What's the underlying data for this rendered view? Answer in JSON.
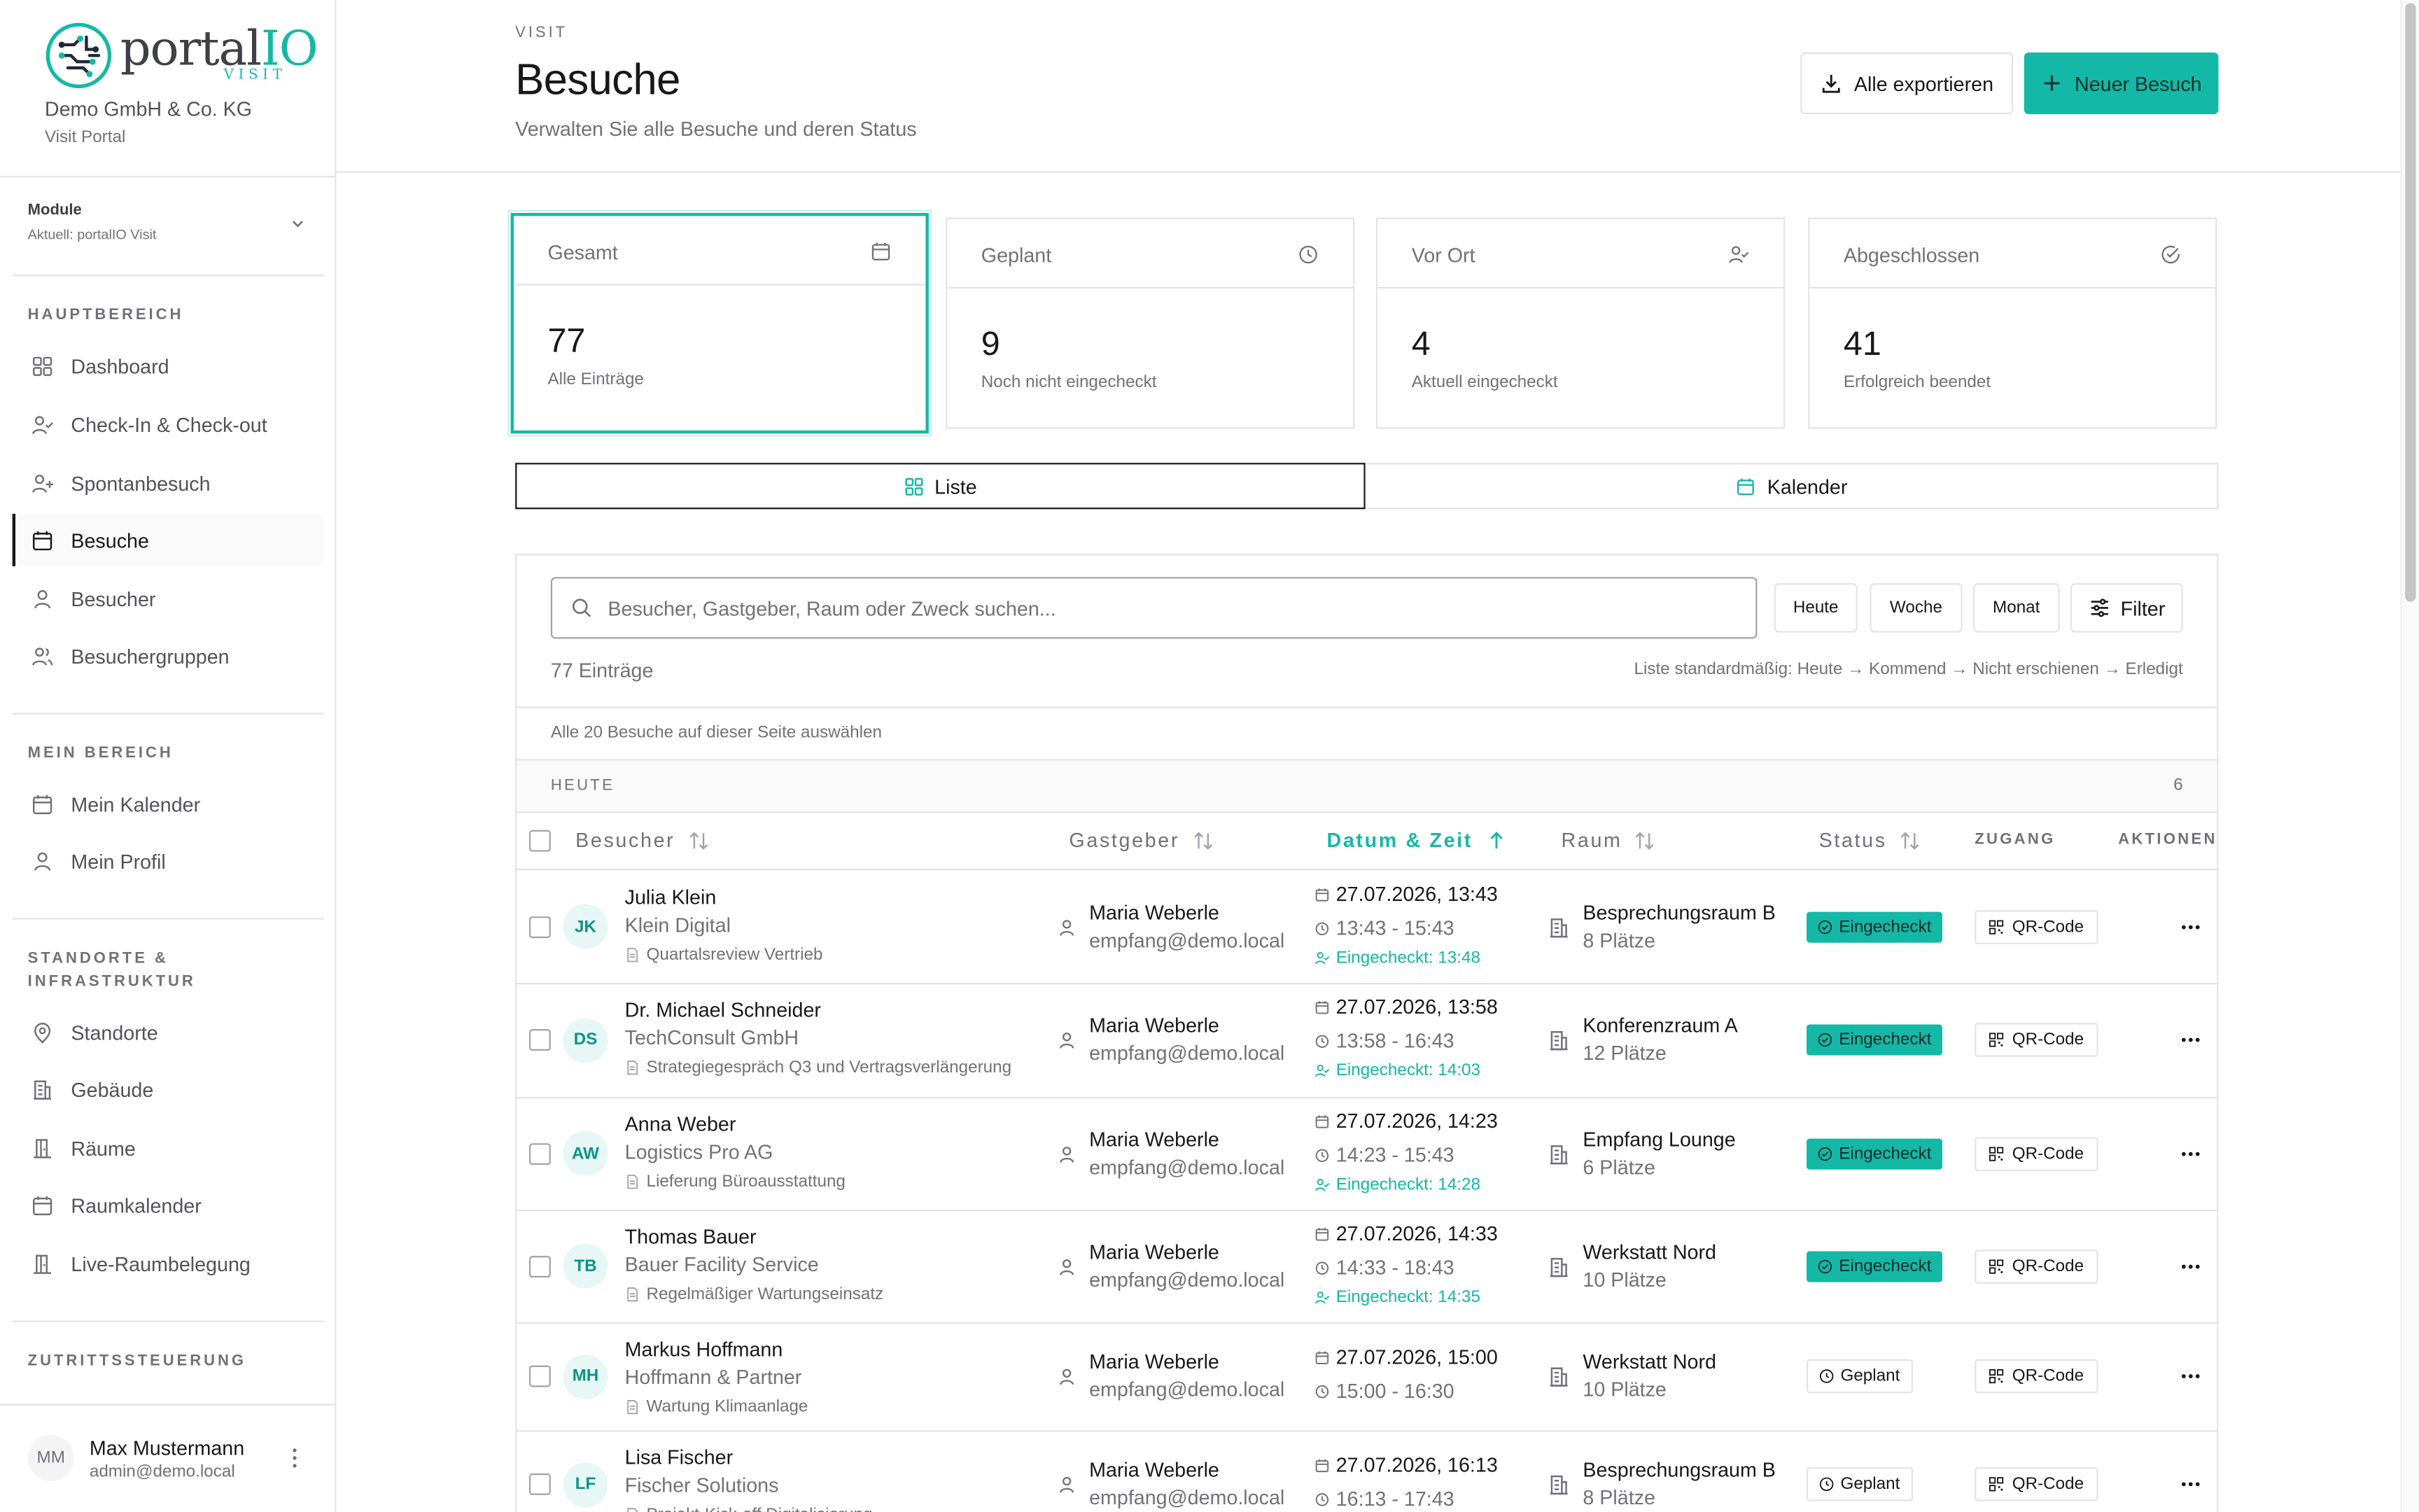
{
  "brand": {
    "name_prefix": "portal",
    "name_suffix": "IO",
    "product": "VISIT",
    "org": "Demo GmbH & Co. KG",
    "portal": "Visit Portal"
  },
  "module": {
    "label": "Module",
    "current": "Aktuell: portalIO Visit"
  },
  "sidebar": {
    "sections": [
      {
        "title": "HAUPTBEREICH",
        "items": [
          {
            "label": "Dashboard",
            "icon": "dashboard-icon"
          },
          {
            "label": "Check-In & Check-out",
            "icon": "user-check-icon"
          },
          {
            "label": "Spontanbesuch",
            "icon": "user-plus-icon"
          },
          {
            "label": "Besuche",
            "icon": "calendar-icon",
            "active": true
          },
          {
            "label": "Besucher",
            "icon": "user-icon"
          },
          {
            "label": "Besuchergruppen",
            "icon": "users-icon"
          }
        ]
      },
      {
        "title": "MEIN BEREICH",
        "items": [
          {
            "label": "Mein Kalender",
            "icon": "calendar-icon"
          },
          {
            "label": "Mein Profil",
            "icon": "user-icon"
          }
        ]
      },
      {
        "title": "STANDORTE & INFRASTRUKTUR",
        "title_line1": "STANDORTE &",
        "title_line2": "INFRASTRUKTUR",
        "items": [
          {
            "label": "Standorte",
            "icon": "map-pin-icon"
          },
          {
            "label": "Gebäude",
            "icon": "building-icon"
          },
          {
            "label": "Räume",
            "icon": "door-icon"
          },
          {
            "label": "Raumkalender",
            "icon": "calendar-icon"
          },
          {
            "label": "Live-Raumbelegung",
            "icon": "door-icon"
          }
        ]
      },
      {
        "title": "ZUTRITTSSTEUERUNG",
        "items": []
      }
    ]
  },
  "user": {
    "initials": "MM",
    "name": "Max Mustermann",
    "email": "admin@demo.local"
  },
  "header": {
    "overline": "VISIT",
    "title": "Besuche",
    "subtitle": "Verwalten Sie alle Besuche und deren Status",
    "export_label": "Alle exportieren",
    "new_label": "Neuer Besuch"
  },
  "stats": [
    {
      "label": "Gesamt",
      "value": "77",
      "desc": "Alle Einträge",
      "icon": "calendar-icon",
      "active": true
    },
    {
      "label": "Geplant",
      "value": "9",
      "desc": "Noch nicht eingecheckt",
      "icon": "clock-icon"
    },
    {
      "label": "Vor Ort",
      "value": "4",
      "desc": "Aktuell eingecheckt",
      "icon": "user-check-icon"
    },
    {
      "label": "Abgeschlossen",
      "value": "41",
      "desc": "Erfolgreich beendet",
      "icon": "check-circle-icon"
    }
  ],
  "view_tabs": [
    {
      "label": "Liste",
      "active": true
    },
    {
      "label": "Kalender"
    }
  ],
  "toolbar": {
    "search_placeholder": "Besucher, Gastgeber, Raum oder Zweck suchen...",
    "quick": [
      "Heute",
      "Woche",
      "Monat"
    ],
    "filter_label": "Filter",
    "count": "77 Einträge",
    "hint": "Liste standardmäßig: Heute → Kommend → Nicht erschienen → Erledigt",
    "select_all": "Alle 20 Besuche auf dieser Seite auswählen"
  },
  "group": {
    "label": "HEUTE",
    "count": "6"
  },
  "columns": {
    "visitor": "Besucher",
    "host": "Gastgeber",
    "datetime": "Datum & Zeit",
    "room": "Raum",
    "status": "Status",
    "access": "ZUGANG",
    "actions": "AKTIONEN"
  },
  "visits": [
    {
      "initials": "JK",
      "name": "Julia Klein",
      "company": "Klein Digital",
      "purpose": "Quartalsreview Vertrieb",
      "host": "Maria Weberle",
      "host_email": "empfang@demo.local",
      "date": "27.07.2026, 13:43",
      "time": "13:43 - 15:43",
      "checkin": "Eingecheckt: 13:48",
      "room": "Besprechungsraum B",
      "capacity": "8 Plätze",
      "status": "Eingecheckt",
      "status_type": "checked-in",
      "access": "QR-Code"
    },
    {
      "initials": "DS",
      "name": "Dr. Michael Schneider",
      "company": "TechConsult GmbH",
      "purpose": "Strategiegespräch Q3 und Vertragsverlängerung",
      "host": "Maria Weberle",
      "host_email": "empfang@demo.local",
      "date": "27.07.2026, 13:58",
      "time": "13:58 - 16:43",
      "checkin": "Eingecheckt: 14:03",
      "room": "Konferenzraum A",
      "capacity": "12 Plätze",
      "status": "Eingecheckt",
      "status_type": "checked-in",
      "access": "QR-Code"
    },
    {
      "initials": "AW",
      "name": "Anna Weber",
      "company": "Logistics Pro AG",
      "purpose": "Lieferung Büroausstattung",
      "host": "Maria Weberle",
      "host_email": "empfang@demo.local",
      "date": "27.07.2026, 14:23",
      "time": "14:23 - 15:43",
      "checkin": "Eingecheckt: 14:28",
      "room": "Empfang Lounge",
      "capacity": "6 Plätze",
      "status": "Eingecheckt",
      "status_type": "checked-in",
      "access": "QR-Code"
    },
    {
      "initials": "TB",
      "name": "Thomas Bauer",
      "company": "Bauer Facility Service",
      "purpose": "Regelmäßiger Wartungseinsatz",
      "host": "Maria Weberle",
      "host_email": "empfang@demo.local",
      "date": "27.07.2026, 14:33",
      "time": "14:33 - 18:43",
      "checkin": "Eingecheckt: 14:35",
      "room": "Werkstatt Nord",
      "capacity": "10 Plätze",
      "status": "Eingecheckt",
      "status_type": "checked-in",
      "access": "QR-Code"
    },
    {
      "initials": "MH",
      "name": "Markus Hoffmann",
      "company": "Hoffmann & Partner",
      "purpose": "Wartung Klimaanlage",
      "host": "Maria Weberle",
      "host_email": "empfang@demo.local",
      "date": "27.07.2026, 15:00",
      "time": "15:00 - 16:30",
      "checkin": "",
      "room": "Werkstatt Nord",
      "capacity": "10 Plätze",
      "status": "Geplant",
      "status_type": "planned",
      "access": "QR-Code"
    },
    {
      "initials": "LF",
      "name": "Lisa Fischer",
      "company": "Fischer Solutions",
      "purpose": "Projekt-Kick-off Digitalisierung",
      "host": "Maria Weberle",
      "host_email": "empfang@demo.local",
      "date": "27.07.2026, 16:13",
      "time": "16:13 - 17:43",
      "checkin": "",
      "room": "Besprechungsraum B",
      "capacity": "8 Plätze",
      "status": "Geplant",
      "status_type": "planned",
      "access": "QR-Code"
    }
  ],
  "colors": {
    "accent": "#14b8a6",
    "text": "#18181b",
    "muted": "#71717a",
    "border": "#e4e4e7"
  }
}
